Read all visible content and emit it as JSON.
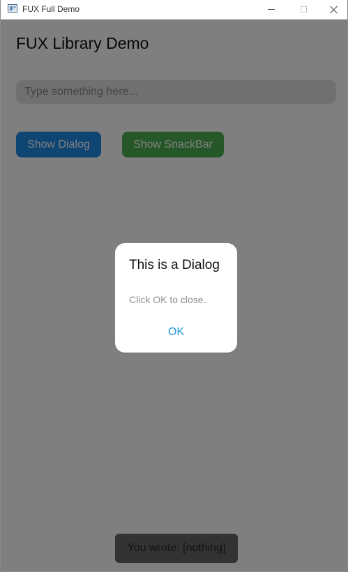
{
  "window": {
    "title": "FUX Full Demo"
  },
  "app": {
    "heading": "FUX Library Demo",
    "input": {
      "value": "",
      "placeholder": "Type something here..."
    },
    "buttons": {
      "show_dialog": "Show Dialog",
      "show_snackbar": "Show SnackBar"
    }
  },
  "dialog": {
    "title": "This is a Dialog",
    "message": "Click OK to close.",
    "ok_label": "OK"
  },
  "snackbar": {
    "text": "You wrote: [nothing]"
  },
  "colors": {
    "primary_button": "#1e8be6",
    "secondary_button": "#4caf50",
    "dialog_ok": "#2196d8",
    "overlay": "rgba(0,0,0,0.5)"
  }
}
